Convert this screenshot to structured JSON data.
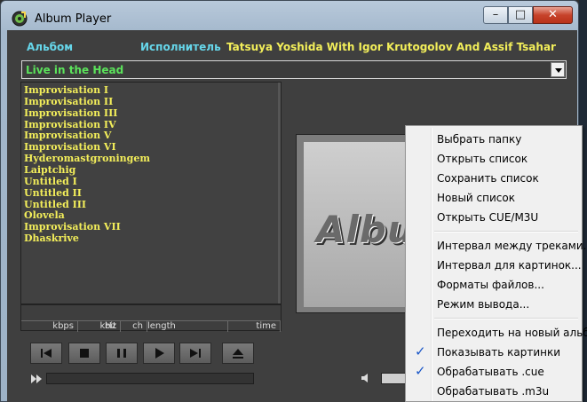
{
  "window": {
    "title": "Album Player"
  },
  "controls": {
    "minimize": "–",
    "maximize": "□",
    "close": "✕"
  },
  "header": {
    "album_label": "Альбом",
    "artist_label": "Исполнитель",
    "artist_value": "Tatsuya Yoshida With Igor Krutogolov And Assif Tsahar"
  },
  "album_select": {
    "value": "Live in the Head"
  },
  "tracks": [
    "Improvisation I",
    "Improvisation II",
    "Improvisation III",
    "Improvisation IV",
    "Improvisation V",
    "Improvisation VI",
    "Hyderomastgroningem",
    "Laiptchig",
    "Untitled I",
    "Untitled II",
    "Untitled III",
    "Olovela",
    "Improvisation VII",
    "Dhaskrive"
  ],
  "info_columns": [
    "kbps",
    "kHz",
    "bit",
    "ch",
    "length",
    "time"
  ],
  "transport": [
    "previous-icon",
    "stop-icon",
    "pause-icon",
    "play-icon",
    "next-icon",
    "eject-icon"
  ],
  "artwork": {
    "text": "Album"
  },
  "context_menu": {
    "group1": [
      "Выбрать папку",
      "Открыть список",
      "Сохранить список",
      "Новый список",
      "Открыть CUE/M3U"
    ],
    "group2": [
      "Интервал между треками...",
      "Интервал для картинок...",
      "Форматы файлов...",
      "Режим вывода..."
    ],
    "group3": [
      {
        "label": "Переходить на новый альбом",
        "checked": false
      },
      {
        "label": "Показывать картинки",
        "checked": true
      },
      {
        "label": "Обрабатывать .cue",
        "checked": true
      },
      {
        "label": "Обрабатывать .m3u",
        "checked": false
      }
    ],
    "check_glyph": "✓"
  },
  "colors": {
    "label_cyan": "#66d6ea",
    "text_yellow": "#f3ee5a",
    "album_green": "#5be25b",
    "check_blue": "#1a57c8"
  }
}
